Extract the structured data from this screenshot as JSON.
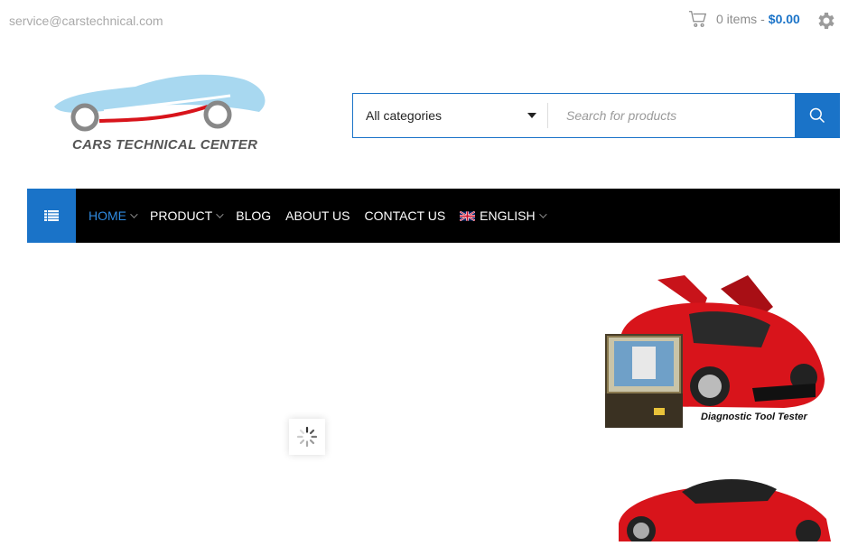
{
  "topbar": {
    "email": "service@carstechnical.com",
    "cart_count": "0 items",
    "cart_sep": "-",
    "cart_total": "$0.00"
  },
  "logo": {
    "text": "CARS TECHNICAL CENTER"
  },
  "search": {
    "category": "All categories",
    "placeholder": "Search for products"
  },
  "nav": {
    "items": [
      {
        "label": "HOME"
      },
      {
        "label": "PRODUCT"
      },
      {
        "label": "BLOG"
      },
      {
        "label": "ABOUT US"
      },
      {
        "label": "CONTACT US"
      },
      {
        "label": "ENGLISH"
      }
    ]
  },
  "banners": {
    "caption": "Diagnostic Tool Tester"
  },
  "colors": {
    "accent": "#1a73c8",
    "nav_bg": "#000000",
    "car_red": "#d8141b"
  },
  "icons": [
    "cart-icon",
    "gear-icon",
    "search-icon",
    "menu-list-icon",
    "chevron-down-icon",
    "uk-flag-icon",
    "loading-spinner-icon"
  ]
}
